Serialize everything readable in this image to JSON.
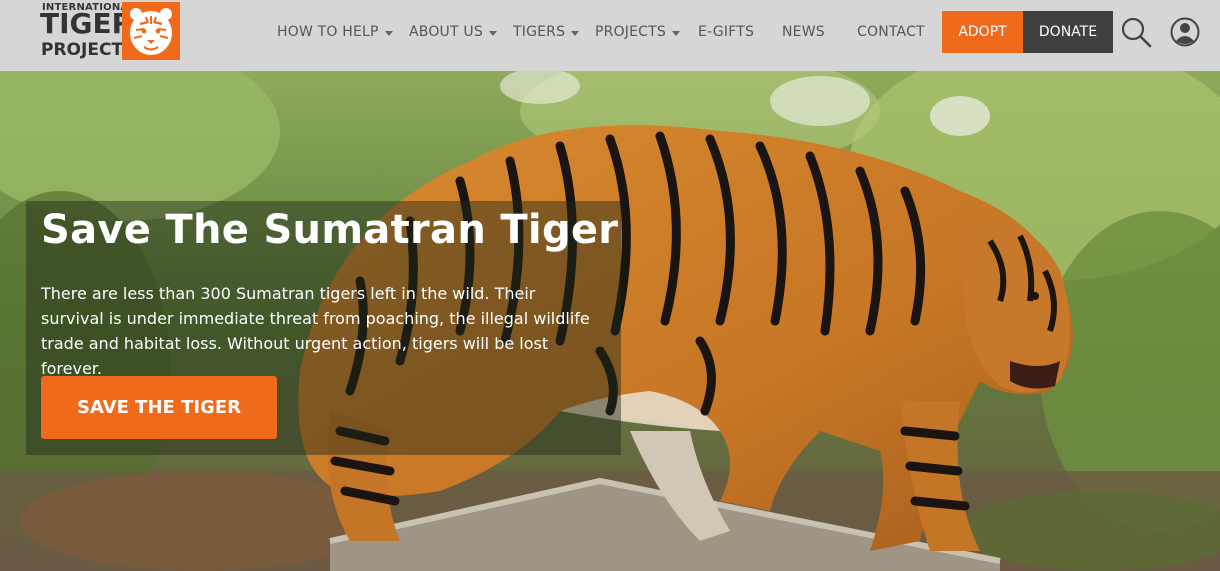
{
  "logo": {
    "line1": "INTERNATIONAL",
    "line2": "TIGER",
    "line3": "PROJECT"
  },
  "nav": {
    "items": [
      {
        "label": "HOW TO HELP",
        "dropdown": true
      },
      {
        "label": "ABOUT US",
        "dropdown": true
      },
      {
        "label": "TIGERS",
        "dropdown": true
      },
      {
        "label": "PROJECTS",
        "dropdown": true
      },
      {
        "label": "E-GIFTS",
        "dropdown": false
      },
      {
        "label": "NEWS",
        "dropdown": false
      },
      {
        "label": "CONTACT",
        "dropdown": false
      }
    ],
    "adopt_label": "ADOPT",
    "donate_label": "DONATE",
    "search_icon": "search-icon",
    "account_icon": "user-icon"
  },
  "hero": {
    "title": "Save The Sumatran Tiger",
    "text": "There are less than 300 Sumatran tigers left in the wild. Their survival is under immediate threat from poaching, the illegal wildlife trade and habitat loss. Without urgent action, tigers will be lost forever.",
    "cta_label": "SAVE THE TIGER"
  },
  "colors": {
    "accent": "#ef6a1a",
    "donate": "#404040",
    "header_bg": "#d6d6d6"
  }
}
